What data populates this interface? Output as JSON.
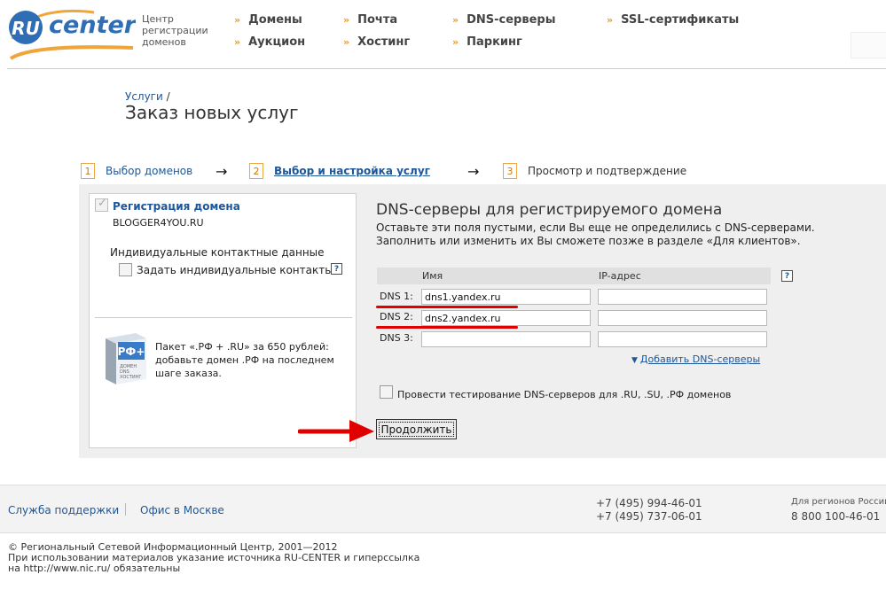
{
  "header": {
    "logo_ru": "RU",
    "logo_center": "center",
    "tagline": [
      "Центр",
      "регистрации",
      "доменов"
    ],
    "nav": [
      {
        "label": "Домены"
      },
      {
        "label": "Почта"
      },
      {
        "label": "DNS-серверы"
      },
      {
        "label": "SSL-сертификаты"
      },
      {
        "label": "Аукцион"
      },
      {
        "label": "Хостинг"
      },
      {
        "label": "Паркинг"
      }
    ],
    "nav_marker": "»"
  },
  "breadcrumb": {
    "link": "Услуги",
    "separator": "/"
  },
  "page_title": "Заказ новых услуг",
  "steps": [
    {
      "num": "1",
      "label": "Выбор доменов"
    },
    {
      "num": "2",
      "label": "Выбор и настройка услуг"
    },
    {
      "num": "3",
      "label": "Просмотр и подтверждение"
    }
  ],
  "step_arrow": "→",
  "left_panel": {
    "reg_title": "Регистрация домена",
    "domain": "BLOGGER4YOU.RU",
    "contact_title": "Индивидуальные контактные данные",
    "contact_checkbox_label": "Задать индивидуальные контакты",
    "help": "?",
    "promo_badge": "РФ+",
    "promo_badge_lines": [
      "ДОМЕН",
      "DNS",
      "ХОСТИНГ"
    ],
    "promo_text": "Пакет «.РФ + .RU» за 650 рублей: добавьте домен .РФ на последнем шаге заказа."
  },
  "dns": {
    "title": "DNS-серверы для регистрируемого домена",
    "desc_line1": "Оставьте эти поля пустыми, если Вы еще не определились с DNS-серверами.",
    "desc_line2": "Заполнить или изменить их Вы сможете позже в разделе «Для клиентов».",
    "col_name": "Имя",
    "col_ip": "IP-адрес",
    "help": "?",
    "rows": [
      {
        "label": "DNS 1:",
        "name": "dns1.yandex.ru",
        "ip": ""
      },
      {
        "label": "DNS 2:",
        "name": "dns2.yandex.ru",
        "ip": ""
      },
      {
        "label": "DNS 3:",
        "name": "",
        "ip": ""
      }
    ],
    "add_marker": "▼",
    "add_link": "Добавить DNS-серверы",
    "test_label": "Провести тестирование DNS-серверов для .RU, .SU, .РФ доменов",
    "continue_button": "Продолжить"
  },
  "footer": {
    "support": "Служба поддержки",
    "office": "Офис в Москве",
    "phone1": "+7 (495) 994-46-01",
    "phone2": "+7 (495) 737-06-01",
    "region_label": "Для регионов России",
    "region_phone": "8 800 100-46-01",
    "copyright1": "© Региональный Сетевой Информационный Центр, 2001—2012",
    "copyright2": "При использовании материалов указание источника RU-CENTER и гиперссылка",
    "copyright3": "на http://www.nic.ru/ обязательны"
  },
  "colors": {
    "link": "#1e5799",
    "accent": "#e99a28",
    "logo_blue": "#2f6db4",
    "annotation_red": "#e00000"
  }
}
